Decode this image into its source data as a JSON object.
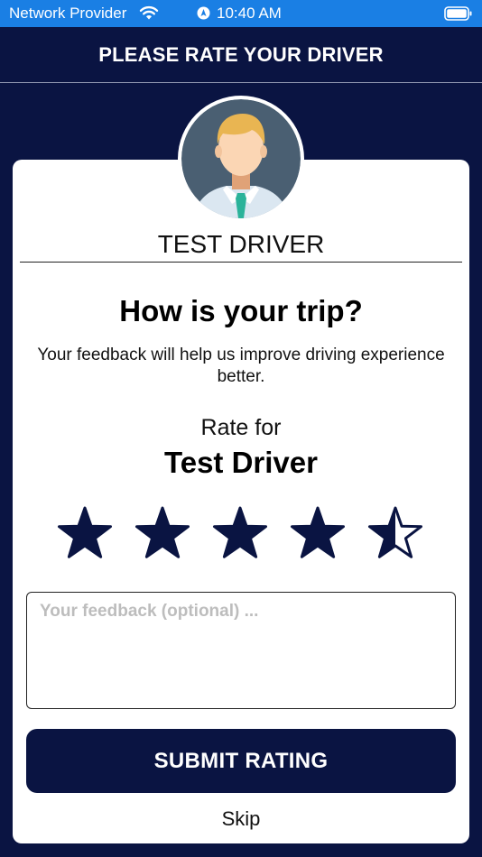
{
  "status_bar": {
    "carrier": "Network Provider",
    "time": "10:40 AM",
    "wifi_icon": "wifi-icon",
    "location_icon": "location-arrow-icon",
    "battery_icon": "battery-icon"
  },
  "header": {
    "title": "PLEASE RATE YOUR DRIVER"
  },
  "driver": {
    "name_upper": "TEST DRIVER",
    "avatar_icon": "driver-avatar-icon"
  },
  "prompt": {
    "question": "How is your trip?",
    "subtitle": "Your feedback will help us improve driving experience better."
  },
  "rating": {
    "label": "Rate for",
    "driver_name": "Test Driver",
    "max_stars": 5,
    "value": 4.5,
    "star_color": "#0a1442"
  },
  "feedback": {
    "value": "",
    "placeholder": "Your feedback (optional) ..."
  },
  "actions": {
    "submit_label": "SUBMIT RATING",
    "skip_label": "Skip"
  },
  "colors": {
    "navy": "#0a1442",
    "status_blue": "#1a7fe4",
    "avatar_bg": "#4a5f72",
    "hair": "#e9b552",
    "tie": "#2bb39a"
  }
}
